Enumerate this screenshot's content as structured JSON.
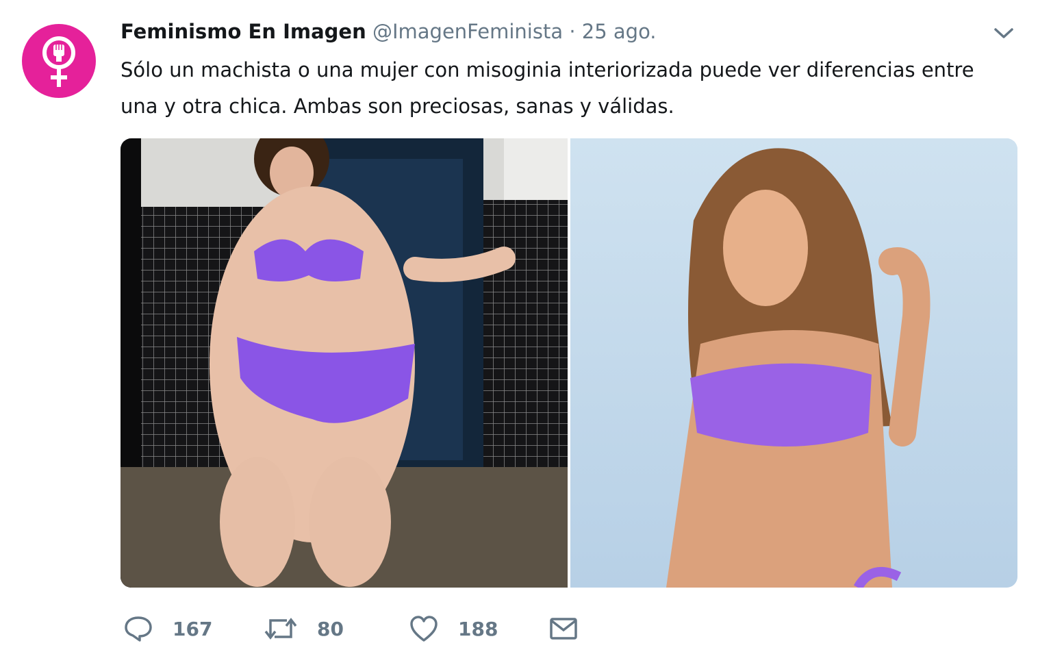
{
  "tweet": {
    "author_name": "Feminismo En Imagen",
    "handle": "@ImagenFeminista",
    "separator": "·",
    "date": "25 ago.",
    "text": "Sólo un machista o una mujer con misoginia interiorizada puede ver diferencias entre una y otra chica. Ambas son preciosas, sanas y válidas.",
    "avatar_icon": "female-symbol-fist-icon",
    "menu_icon": "chevron-down-icon"
  },
  "actions": {
    "reply_count": "167",
    "retweet_count": "80",
    "like_count": "188",
    "icons": [
      "reply-icon",
      "retweet-icon",
      "like-icon",
      "direct-message-icon"
    ]
  },
  "media": {
    "photos": [
      "photo-left",
      "photo-right"
    ]
  },
  "colors": {
    "avatar_bg": "#e5219a",
    "text": "#14171a",
    "secondary": "#657786",
    "bikini": "#8a55e6"
  }
}
